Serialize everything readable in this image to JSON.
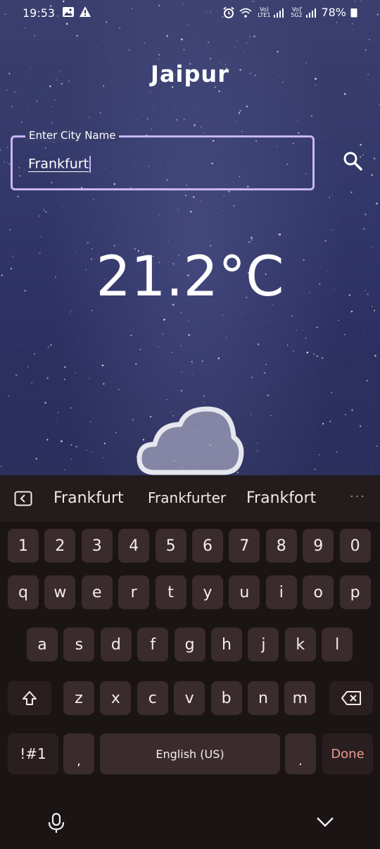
{
  "status_bar": {
    "time": "19:53",
    "battery": "78%",
    "left_icons": [
      "image-icon",
      "warning-icon"
    ],
    "right_icons": [
      "alarm-icon",
      "wifi-icon",
      "signal-icon",
      "signal-icon"
    ],
    "sim1_label": "Vo) LTE1",
    "sim2_label": "Vo) 5G2"
  },
  "app": {
    "city": "Jaipur",
    "input_label": "Enter City Name",
    "input_value": "Frankfurt",
    "temperature": "21.2°C",
    "weather_icon": "cloud-icon"
  },
  "keyboard": {
    "suggestions": [
      "Frankfurt",
      "Frankfurter",
      "Frankfort"
    ],
    "more": "···",
    "row_numbers": [
      "1",
      "2",
      "3",
      "4",
      "5",
      "6",
      "7",
      "8",
      "9",
      "0"
    ],
    "row1": [
      "q",
      "w",
      "e",
      "r",
      "t",
      "y",
      "u",
      "i",
      "o",
      "p"
    ],
    "row2": [
      "a",
      "s",
      "d",
      "f",
      "g",
      "h",
      "j",
      "k",
      "l"
    ],
    "row3": [
      "z",
      "x",
      "c",
      "v",
      "b",
      "n",
      "m"
    ],
    "symbols": "!#1",
    "comma": ",",
    "space": "English (US)",
    "period": ".",
    "done": "Done",
    "done_color": "#e89a90"
  },
  "nav": {
    "mic_icon": "mic-icon",
    "hide_icon": "chevron-down-icon"
  }
}
